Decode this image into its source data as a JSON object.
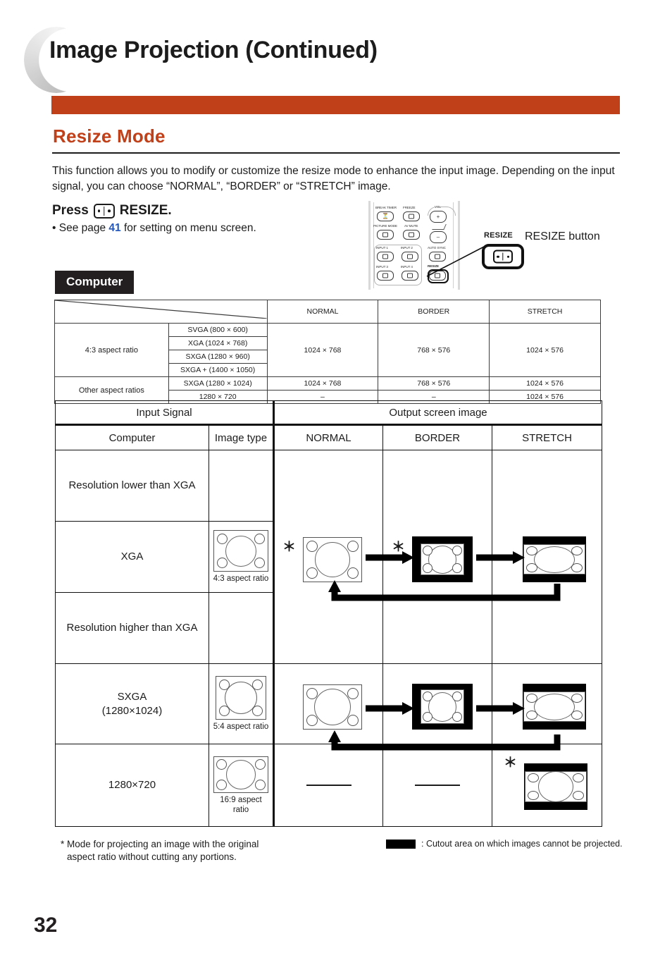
{
  "page": {
    "title": "Image Projection (Continued)",
    "section_heading": "Resize Mode",
    "number": "32"
  },
  "intro": {
    "paragraph": "This function allows you to modify or customize the resize mode to enhance the input image. Depending on the input signal, you can choose “NORMAL”, “BORDER” or “STRETCH” image.",
    "press_prefix": "Press",
    "press_suffix": "RESIZE.",
    "see_prefix": "• See page",
    "see_page_number": "41",
    "see_suffix": "for setting on menu screen."
  },
  "remote": {
    "callout_label": "RESIZE",
    "callout_text": "RESIZE button",
    "keys": {
      "break_timer": "BREAK TIMER",
      "freeze": "FREEZE",
      "vol": "VOL",
      "picture_mode": "PICTURE MODE",
      "av_mute": "AV MUTE",
      "input1": "INPUT 1",
      "input2": "INPUT 2",
      "auto_sync": "AUTO SYNC",
      "input3": "INPUT 3",
      "input4": "INPUT 4",
      "resize": "RESIZE",
      "vol_plus": "+",
      "vol_minus": "–"
    }
  },
  "computer_tag": "Computer",
  "table1": {
    "headers": [
      "",
      "",
      "NORMAL",
      "BORDER",
      "STRETCH"
    ],
    "group_labels": [
      "4:3 aspect ratio",
      "Other aspect ratios"
    ],
    "rows_43": [
      "SVGA (800 × 600)",
      "XGA (1024 × 768)",
      "SXGA (1280 × 960)",
      "SXGA + (1400 × 1050)"
    ],
    "values_43": {
      "normal": "1024 × 768",
      "border": "768 × 576",
      "stretch": "1024 × 576"
    },
    "rows_other": [
      {
        "signal": "SXGA (1280 × 1024)",
        "normal": "1024 × 768",
        "border": "768 × 576",
        "stretch": "1024 × 576"
      },
      {
        "signal": "1280 × 720",
        "normal": "–",
        "border": "–",
        "stretch": "1024 × 576"
      }
    ]
  },
  "table2": {
    "header_input_signal": "Input Signal",
    "header_output": "Output screen image",
    "col_computer": "Computer",
    "col_image_type": "Image type",
    "col_normal": "NORMAL",
    "col_border": "BORDER",
    "col_stretch": "STRETCH",
    "rows": [
      {
        "computer": "Resolution lower than XGA",
        "image_type_caption": ""
      },
      {
        "computer": "XGA",
        "image_type_caption": "4:3 aspect ratio"
      },
      {
        "computer": "Resolution higher than XGA",
        "image_type_caption": ""
      },
      {
        "computer": "SXGA\n(1280 × 1024)",
        "image_type_caption": "5:4 aspect ratio"
      },
      {
        "computer": "1280 × 720",
        "image_type_caption": "16:9 aspect\nratio"
      }
    ],
    "row_sxga_line1": "SXGA",
    "row_sxga_line2": "(1280×1024)",
    "row_1280_720": "1280×720",
    "cap_43": "4:3 aspect ratio",
    "cap_54": "5:4 aspect ratio",
    "cap_169_l1": "16:9 aspect",
    "cap_169_l2": "ratio",
    "star": "＊",
    "dash": "—"
  },
  "footnotes": {
    "left_line1": "* Mode for projecting an image with the original",
    "left_line2": "aspect ratio without cutting any portions.",
    "right": ": Cutout area on which images cannot be projected."
  },
  "colors": {
    "accent": "#c0401a",
    "link": "#2457b8",
    "ink": "#1c1c1c",
    "tag_bg": "#231f20"
  }
}
